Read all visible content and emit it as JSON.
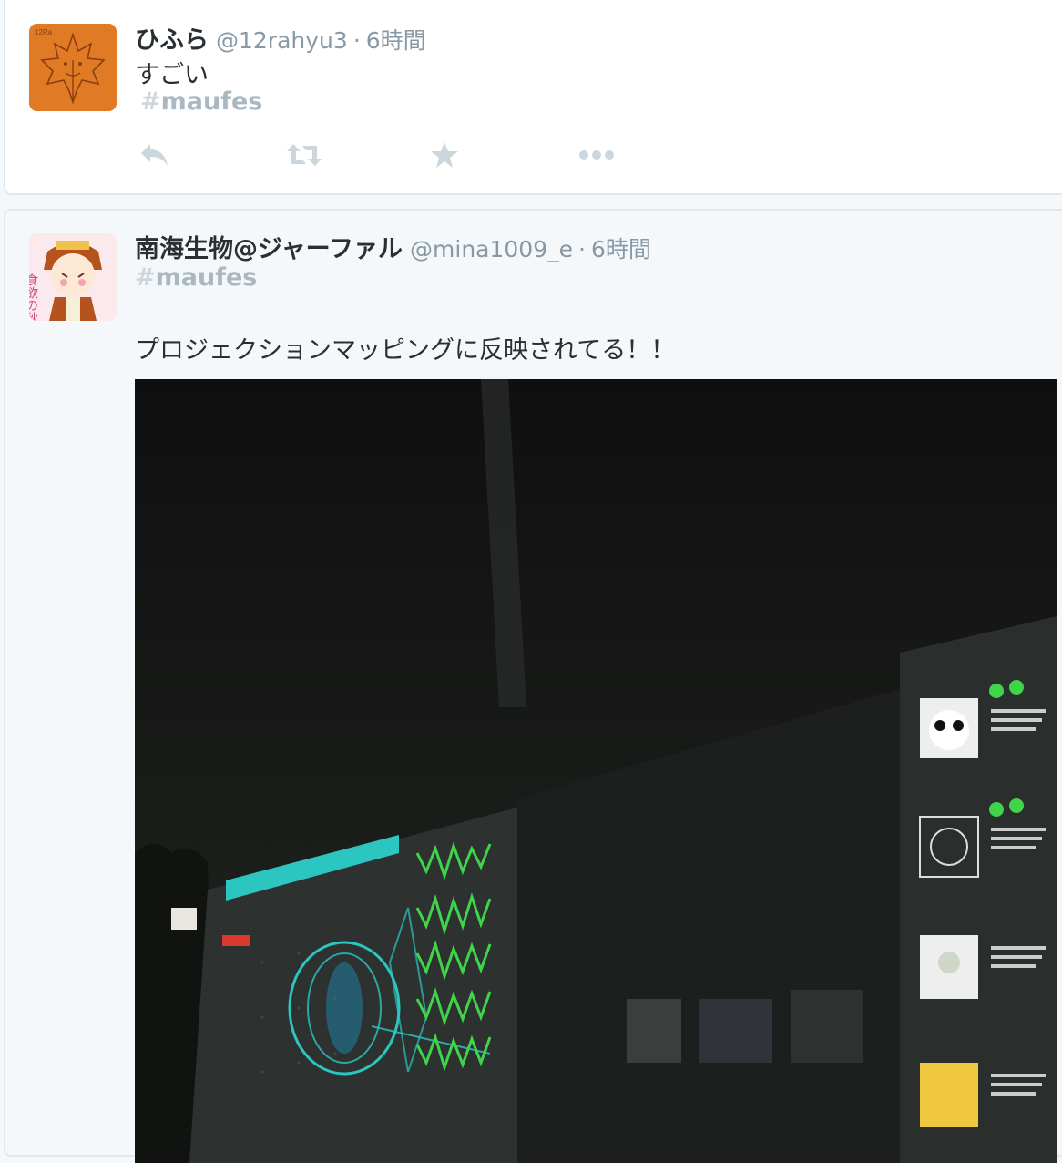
{
  "tweets": [
    {
      "name": "ひふら",
      "handle": "@12rahyu3",
      "dot": "·",
      "time": "6時間",
      "text": "すごい",
      "hashtag_hash": "#",
      "hashtag_word": "maufes",
      "actions": [
        "reply-icon",
        "retweet-icon",
        "favorite-icon",
        "more-icon"
      ]
    },
    {
      "name": "南海生物@ジャーファル",
      "handle": "@mina1009_e",
      "dot": "·",
      "time": "6時間",
      "hashtag_hash": "#",
      "hashtag_word": "maufes",
      "text": "プロジェクションマッピングに反映されてる！！",
      "avatar_text": "食欲の秋",
      "media": "projection-mapping-photo"
    }
  ],
  "colors": {
    "name": "#292f33",
    "meta": "#8899a6",
    "hashtag": "#aab8c2",
    "action_icon": "#ccd6dd",
    "tweet1_bg": "#ffffff",
    "tweet2_bg": "#f5f8fa",
    "projection_green": "#3fd44a",
    "projection_cyan": "#2cc6c0"
  }
}
